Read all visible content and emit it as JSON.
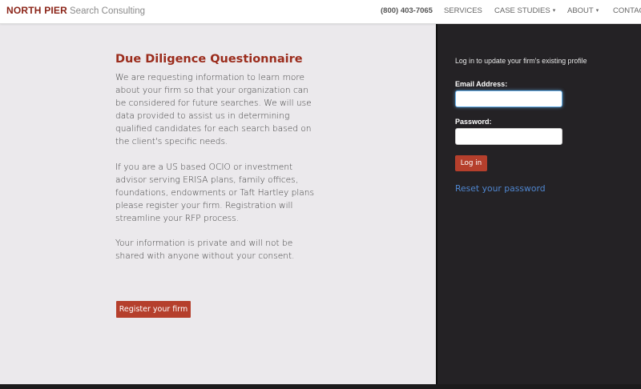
{
  "brand": {
    "name_strong": "NORTH PIER",
    "name_light": "Search Consulting"
  },
  "nav": {
    "phone": "(800) 403-7065",
    "items": [
      {
        "label": "SERVICES",
        "has_dropdown": false
      },
      {
        "label": "CASE STUDIES",
        "has_dropdown": true
      },
      {
        "label": "ABOUT",
        "has_dropdown": true
      },
      {
        "label": "CONTACT",
        "has_dropdown": false
      }
    ],
    "dropdown_caret": "▾"
  },
  "main": {
    "heading": "Due Diligence Questionnaire",
    "paragraphs": [
      "We are requesting information to learn more about your firm so that your organization can be considered for future searches. We will use data provided to assist us in determining qualified candidates for each search based on the client's specific needs.",
      "If you are a US based OCIO or investment advisor serving ERISA plans, family offices, foundations, endowments or Taft Hartley plans please register your firm. Registration will streamline your RFP process.",
      "Your information is private and will not be shared with anyone without your consent."
    ],
    "register_button": "Register your firm"
  },
  "login": {
    "intro": "Log in to update your firm's existing profile",
    "email_label": "Email Address:",
    "email_value": "",
    "password_label": "Password:",
    "password_value": "",
    "login_button": "Log in",
    "reset_link": "Reset your password"
  },
  "colors": {
    "brand_red": "#8b2418",
    "button_red": "#b53f2c",
    "sidebar_bg": "#242225",
    "page_bg": "#ebe9ec",
    "link_blue": "#4f86cf"
  }
}
